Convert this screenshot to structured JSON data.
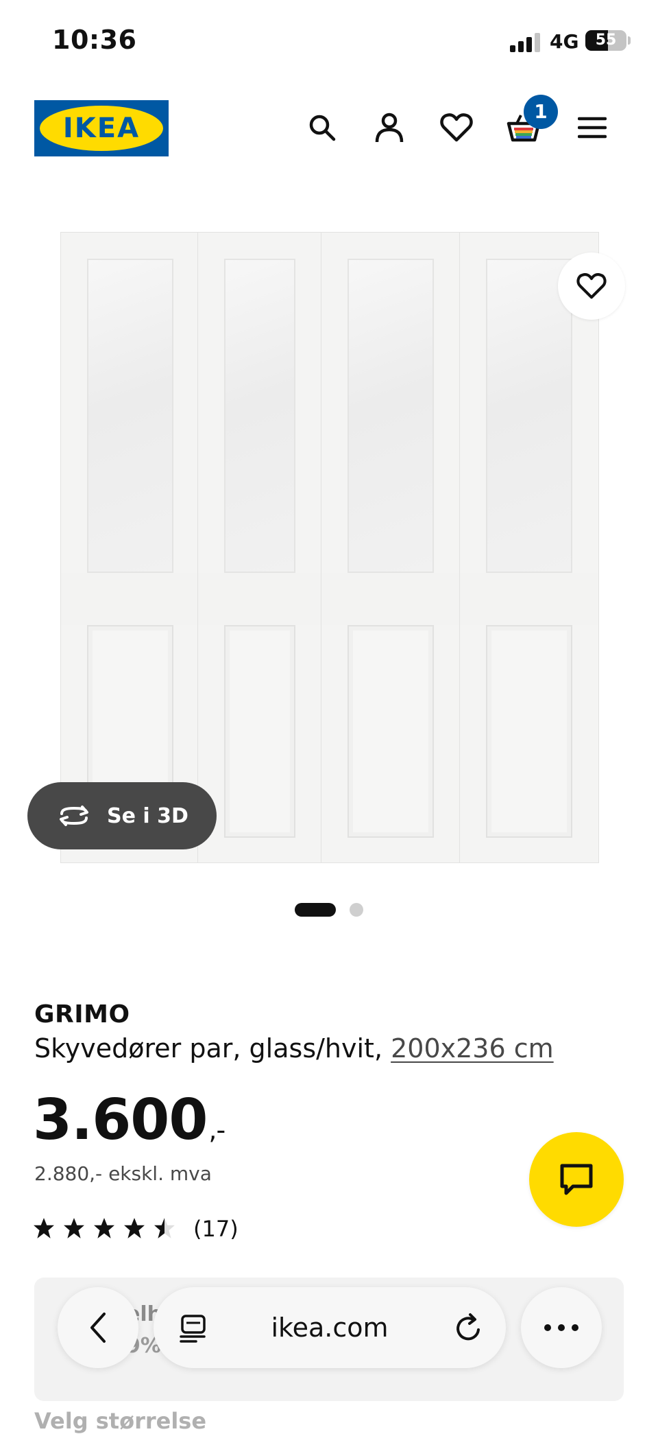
{
  "status_bar": {
    "time": "10:36",
    "network": "4G",
    "battery_level": "55",
    "battery_fraction": 0.55
  },
  "header": {
    "logo_text": "IKEA",
    "cart_count": "1",
    "icons": [
      "search-icon",
      "account-icon",
      "favourites-icon",
      "cart-icon",
      "menu-icon"
    ]
  },
  "gallery": {
    "view_3d_label": "Se i 3D",
    "image_count": 2,
    "active_image_index": 0
  },
  "product": {
    "name": "GRIMO",
    "description": "Skyvedører par, glass/hvit, ",
    "size": "200x236 cm",
    "price": "3.600",
    "price_suffix": ",-",
    "price_excl_vat": "2.880,- ekskl. mva",
    "rating": 4.5,
    "review_count": "(17)"
  },
  "promo_card": {
    "line1": "elh",
    "line2": "9%"
  },
  "size_section": {
    "label": "Velg størrelse"
  },
  "browser": {
    "domain": "ikea.com"
  },
  "colors": {
    "ikea_blue": "#0058a3",
    "ikea_yellow": "#ffdb00",
    "dark_pill": "#484848"
  }
}
